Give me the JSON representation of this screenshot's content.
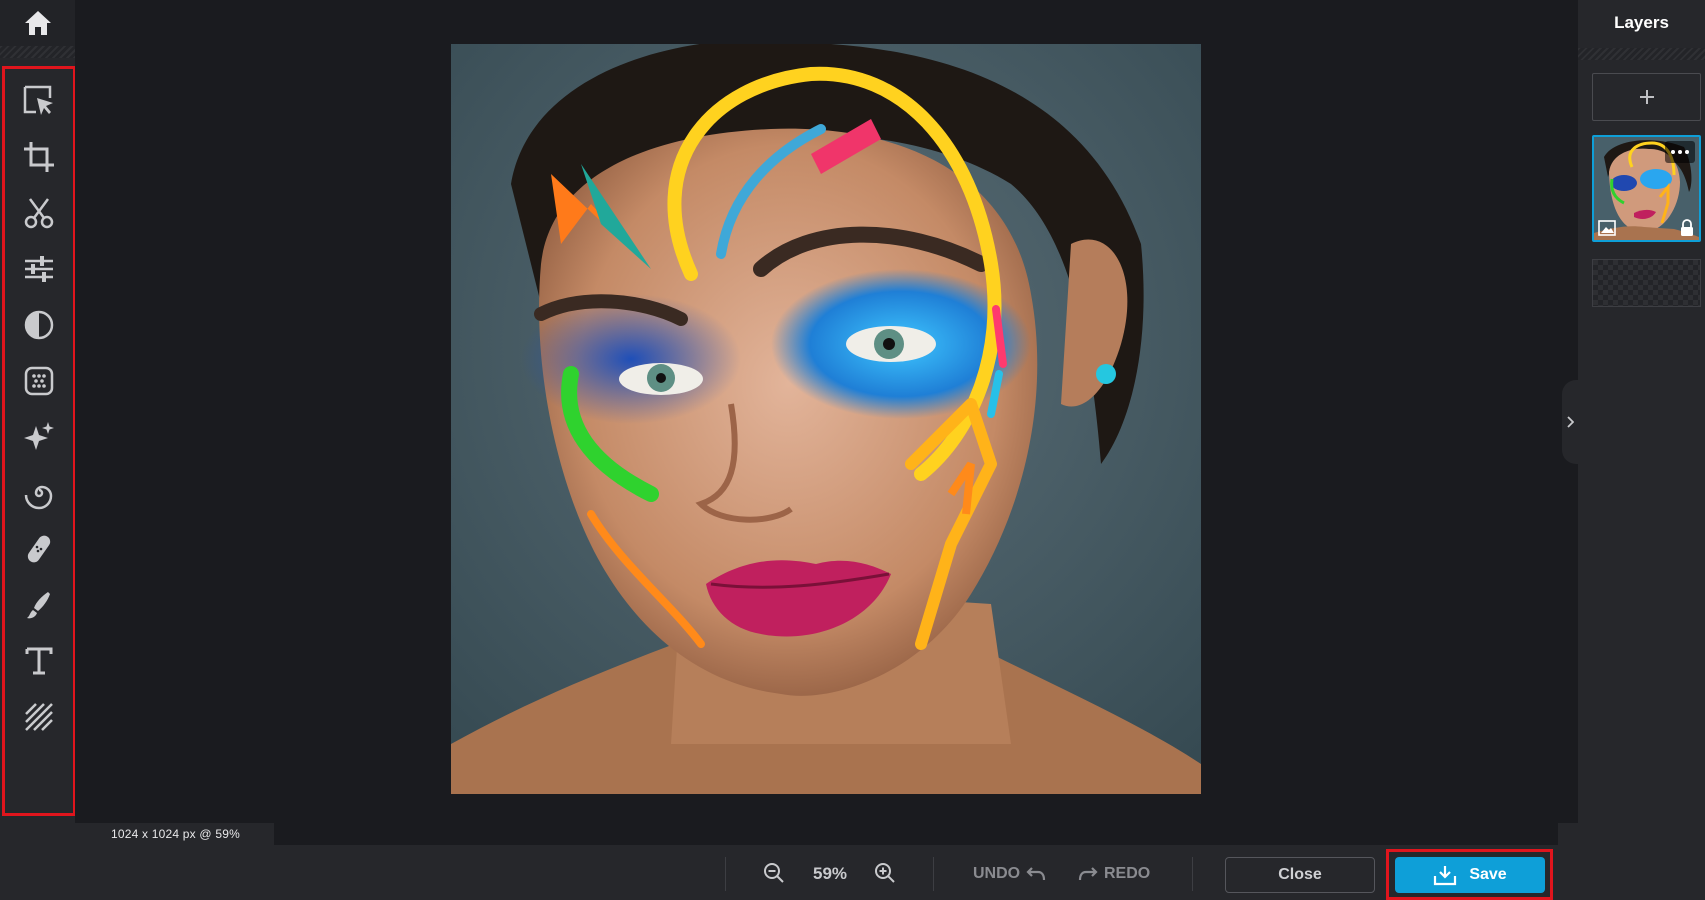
{
  "toolbar": {
    "home_icon": "home-icon",
    "tools": [
      {
        "name": "arrange",
        "icon": "select-arrow-icon"
      },
      {
        "name": "crop",
        "icon": "crop-icon"
      },
      {
        "name": "cutout",
        "icon": "scissors-icon"
      },
      {
        "name": "adjust",
        "icon": "sliders-icon"
      },
      {
        "name": "effects",
        "icon": "half-circle-icon"
      },
      {
        "name": "filter",
        "icon": "dots-grid-icon"
      },
      {
        "name": "retouch",
        "icon": "sparkle-icon"
      },
      {
        "name": "liquify",
        "icon": "spiral-icon"
      },
      {
        "name": "heal",
        "icon": "bandage-icon"
      },
      {
        "name": "draw",
        "icon": "brush-icon"
      },
      {
        "name": "text",
        "icon": "text-icon"
      },
      {
        "name": "texture",
        "icon": "diagonal-lines-icon"
      }
    ]
  },
  "canvas": {
    "dimension_label": "1024 x 1024 px @ 59%"
  },
  "bottom_bar": {
    "zoom_value": "59%",
    "undo_label": "UNDO",
    "redo_label": "REDO",
    "close_label": "Close",
    "save_label": "Save"
  },
  "layers_panel": {
    "title": "Layers",
    "add_icon": "plus-icon"
  },
  "colors": {
    "accent": "#0e9fd8",
    "highlight": "#e0151d",
    "panel": "#26272b",
    "background": "#1a1b1f"
  }
}
